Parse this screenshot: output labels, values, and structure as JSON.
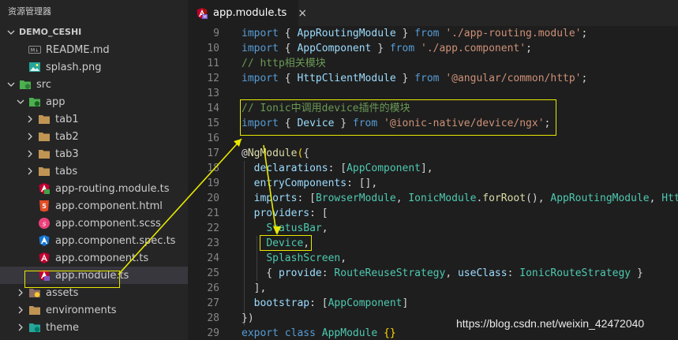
{
  "sidebar": {
    "title": "资源管理器",
    "project": "DEMO_CESHI",
    "items": [
      {
        "label": "README.md",
        "icon": "markdown-file-icon",
        "depth": 1,
        "chevron": "none"
      },
      {
        "label": "splash.png",
        "icon": "image-file-icon",
        "depth": 1,
        "chevron": "none"
      },
      {
        "label": "src",
        "icon": "folder-src-icon",
        "depth": 0,
        "chevron": "down"
      },
      {
        "label": "app",
        "icon": "folder-app-icon",
        "depth": 1,
        "chevron": "down"
      },
      {
        "label": "tab1",
        "icon": "folder-icon",
        "depth": 2,
        "chevron": "right"
      },
      {
        "label": "tab2",
        "icon": "folder-icon",
        "depth": 2,
        "chevron": "right"
      },
      {
        "label": "tab3",
        "icon": "folder-icon",
        "depth": 2,
        "chevron": "right"
      },
      {
        "label": "tabs",
        "icon": "folder-icon",
        "depth": 2,
        "chevron": "right"
      },
      {
        "label": "app-routing.module.ts",
        "icon": "angular-routing-icon",
        "depth": 2,
        "chevron": "none"
      },
      {
        "label": "app.component.html",
        "icon": "html5-file-icon",
        "depth": 2,
        "chevron": "none"
      },
      {
        "label": "app.component.scss",
        "icon": "scss-file-icon",
        "depth": 2,
        "chevron": "none"
      },
      {
        "label": "app.component.spec.ts",
        "icon": "spec-file-icon",
        "depth": 2,
        "chevron": "none"
      },
      {
        "label": "app.component.ts",
        "icon": "angular-component-icon",
        "depth": 2,
        "chevron": "none"
      },
      {
        "label": "app.module.ts",
        "icon": "angular-module-icon",
        "depth": 2,
        "chevron": "none",
        "selected": true
      },
      {
        "label": "assets",
        "icon": "folder-assets-icon",
        "depth": 1,
        "chevron": "right"
      },
      {
        "label": "environments",
        "icon": "folder-icon",
        "depth": 1,
        "chevron": "right"
      },
      {
        "label": "theme",
        "icon": "folder-theme-icon",
        "depth": 1,
        "chevron": "right"
      }
    ]
  },
  "tab": {
    "label": "app.module.ts",
    "close": "×"
  },
  "editor": {
    "lines": [
      {
        "n": "9",
        "tokens": [
          [
            "kw",
            "import"
          ],
          [
            "pn",
            " { "
          ],
          [
            "vr",
            "AppRoutingModule"
          ],
          [
            "pn",
            " } "
          ],
          [
            "kw",
            "from"
          ],
          [
            "pn",
            " "
          ],
          [
            "st",
            "'./app-routing.module'"
          ],
          [
            "pn",
            ";"
          ]
        ]
      },
      {
        "n": "10",
        "tokens": [
          [
            "kw",
            "import"
          ],
          [
            "pn",
            " { "
          ],
          [
            "vr",
            "AppComponent"
          ],
          [
            "pn",
            " } "
          ],
          [
            "kw",
            "from"
          ],
          [
            "pn",
            " "
          ],
          [
            "st",
            "'./app.component'"
          ],
          [
            "pn",
            ";"
          ]
        ]
      },
      {
        "n": "11",
        "tokens": [
          [
            "cm",
            "// http相关模块"
          ]
        ]
      },
      {
        "n": "12",
        "tokens": [
          [
            "kw",
            "import"
          ],
          [
            "pn",
            " { "
          ],
          [
            "vr",
            "HttpClientModule"
          ],
          [
            "pn",
            " } "
          ],
          [
            "kw",
            "from"
          ],
          [
            "pn",
            " "
          ],
          [
            "st",
            "'@angular/common/http'"
          ],
          [
            "pn",
            ";"
          ]
        ]
      },
      {
        "n": "13",
        "tokens": []
      },
      {
        "n": "14",
        "tokens": [
          [
            "cm",
            "// Ionic中调用device插件的模块"
          ]
        ]
      },
      {
        "n": "15",
        "tokens": [
          [
            "kw",
            "import"
          ],
          [
            "pn",
            " { "
          ],
          [
            "vr",
            "Device"
          ],
          [
            "pn",
            " } "
          ],
          [
            "kw",
            "from"
          ],
          [
            "pn",
            " "
          ],
          [
            "st",
            "'@ionic-native/device/ngx'"
          ],
          [
            "pn",
            ";"
          ]
        ]
      },
      {
        "n": "16",
        "tokens": []
      },
      {
        "n": "17",
        "tokens": [
          [
            "pn",
            "@"
          ],
          [
            "fn",
            "NgModule"
          ],
          [
            "br",
            "("
          ],
          [
            "pn",
            "{"
          ]
        ]
      },
      {
        "n": "18",
        "tokens": [
          [
            "pn",
            "  "
          ],
          [
            "vr",
            "declarations"
          ],
          [
            "pn",
            ": ["
          ],
          [
            "ty",
            "AppComponent"
          ],
          [
            "pn",
            "],"
          ]
        ]
      },
      {
        "n": "19",
        "tokens": [
          [
            "pn",
            "  "
          ],
          [
            "vr",
            "entryComponents"
          ],
          [
            "pn",
            ": [],"
          ]
        ]
      },
      {
        "n": "20",
        "tokens": [
          [
            "pn",
            "  "
          ],
          [
            "vr",
            "imports"
          ],
          [
            "pn",
            ": ["
          ],
          [
            "ty",
            "BrowserModule"
          ],
          [
            "pn",
            ", "
          ],
          [
            "ty",
            "IonicModule"
          ],
          [
            "pn",
            "."
          ],
          [
            "fn",
            "forRoot"
          ],
          [
            "pn",
            "(), "
          ],
          [
            "ty",
            "AppRoutingModule"
          ],
          [
            "pn",
            ", "
          ],
          [
            "ty",
            "HttpClientModule"
          ]
        ]
      },
      {
        "n": "21",
        "tokens": [
          [
            "pn",
            "  "
          ],
          [
            "vr",
            "providers"
          ],
          [
            "pn",
            ": ["
          ]
        ]
      },
      {
        "n": "22",
        "tokens": [
          [
            "pn",
            "    "
          ],
          [
            "ty",
            "StatusBar"
          ],
          [
            "pn",
            ","
          ]
        ]
      },
      {
        "n": "23",
        "tokens": [
          [
            "pn",
            "    "
          ],
          [
            "ty",
            "Device"
          ],
          [
            "pn",
            ","
          ]
        ]
      },
      {
        "n": "24",
        "tokens": [
          [
            "pn",
            "    "
          ],
          [
            "ty",
            "SplashScreen"
          ],
          [
            "pn",
            ","
          ]
        ]
      },
      {
        "n": "25",
        "tokens": [
          [
            "pn",
            "    { "
          ],
          [
            "vr",
            "provide"
          ],
          [
            "pn",
            ": "
          ],
          [
            "ty",
            "RouteReuseStrategy"
          ],
          [
            "pn",
            ", "
          ],
          [
            "vr",
            "useClass"
          ],
          [
            "pn",
            ": "
          ],
          [
            "ty",
            "IonicRouteStrategy"
          ],
          [
            "pn",
            " }"
          ]
        ]
      },
      {
        "n": "26",
        "tokens": [
          [
            "pn",
            "  ],"
          ]
        ]
      },
      {
        "n": "27",
        "tokens": [
          [
            "pn",
            "  "
          ],
          [
            "vr",
            "bootstrap"
          ],
          [
            "pn",
            ": ["
          ],
          [
            "ty",
            "AppComponent"
          ],
          [
            "pn",
            "]"
          ]
        ]
      },
      {
        "n": "28",
        "tokens": [
          [
            "pn",
            "})"
          ]
        ]
      },
      {
        "n": "29",
        "tokens": [
          [
            "kw",
            "export"
          ],
          [
            "pn",
            " "
          ],
          [
            "kw",
            "class"
          ],
          [
            "pn",
            " "
          ],
          [
            "ty",
            "AppModule"
          ],
          [
            "pn",
            " "
          ],
          [
            "br",
            "{}"
          ]
        ]
      }
    ]
  },
  "watermark": "https://blog.csdn.net/weixin_42472040",
  "colors": {
    "annotation": "#e8e800",
    "selection": "#37373d",
    "accent": "#007acc"
  }
}
